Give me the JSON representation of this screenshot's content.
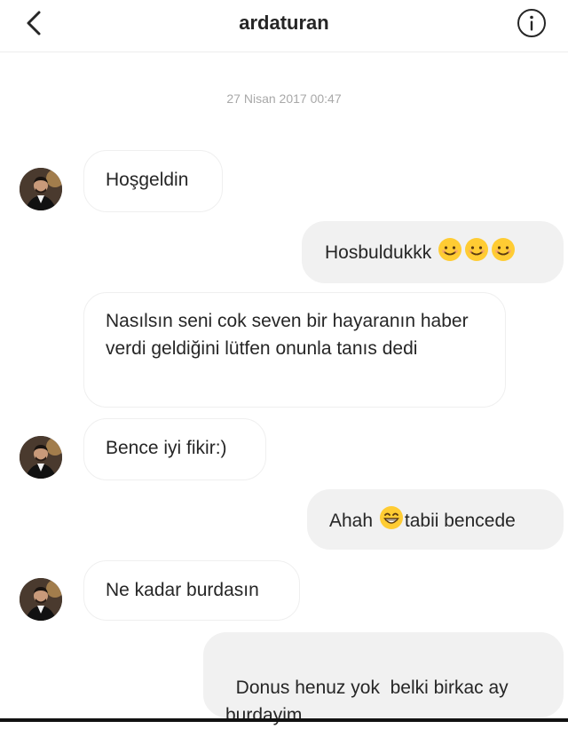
{
  "header": {
    "title": "ardaturan",
    "back_icon": "chevron-left-icon",
    "info_icon": "info-circle-icon"
  },
  "timestamp": "27 Nisan 2017 00:47",
  "messages": [
    {
      "side": "in",
      "text": "Hoşgeldin"
    },
    {
      "side": "out",
      "text": "Hosbuldukkk",
      "emojis": [
        "smiling-face-icon",
        "smiling-face-icon",
        "smiling-face-icon"
      ]
    },
    {
      "side": "in",
      "text": "Nasılsın seni cok seven bir hayaranın haber verdi geldiğini lütfen onunla tanıs dedi"
    },
    {
      "side": "in",
      "text": "Bence iyi fikir:)"
    },
    {
      "side": "out",
      "text_before": "Ahah",
      "emoji": "grinning-face-icon",
      "text_after": "tabii bencede"
    },
    {
      "side": "in",
      "text": "Ne kadar burdasın"
    },
    {
      "side": "out",
      "text": "Donus henuz yok  belki birkac ay burdayim"
    }
  ],
  "colors": {
    "outgoing_bubble": "#f1f1f1",
    "incoming_border": "#efefef",
    "timestamp": "#a8a8a8",
    "text": "#262626"
  }
}
